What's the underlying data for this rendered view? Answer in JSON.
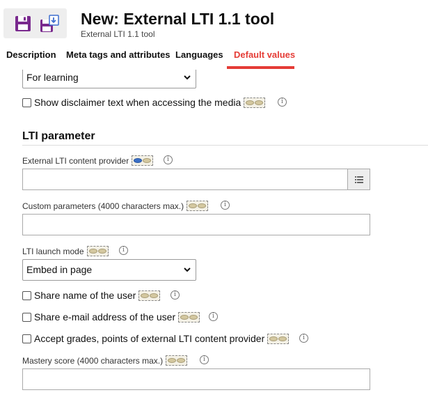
{
  "header": {
    "title": "New: External LTI 1.1 tool",
    "subtitle": "External LTI 1.1 tool",
    "icons": [
      "save-icon",
      "save-as-icon"
    ]
  },
  "tabs": [
    {
      "label": "Description",
      "active": false
    },
    {
      "label": "Meta tags and attributes",
      "active": false
    },
    {
      "label": "Languages",
      "active": false
    },
    {
      "label": "Default values",
      "active": true
    }
  ],
  "form": {
    "usage_select": {
      "value": "For learning"
    },
    "disclaimer": {
      "label": "Show disclaimer text when accessing the media",
      "checked": false
    },
    "section_title": "LTI parameter",
    "content_provider": {
      "label": "External LTI content provider",
      "value": ""
    },
    "custom_params": {
      "label": "Custom parameters (4000 characters max.)",
      "value": ""
    },
    "launch_mode": {
      "label": "LTI launch mode",
      "value": "Embed in page"
    },
    "share_name": {
      "label": "Share name of the user",
      "checked": false
    },
    "share_email": {
      "label": "Share e-mail address of the user",
      "checked": false
    },
    "accept_grades": {
      "label": "Accept grades, points of external LTI content provider",
      "checked": false
    },
    "mastery_score": {
      "label": "Mastery score (4000 characters max.)",
      "value": ""
    }
  },
  "colors": {
    "accent": "#e53c36",
    "toolbar_bg": "#eeeeee"
  }
}
